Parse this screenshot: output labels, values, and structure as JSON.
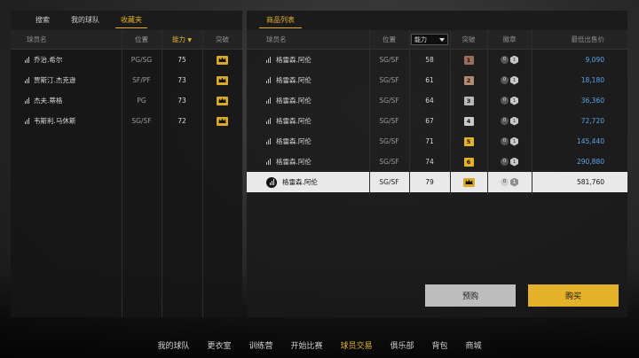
{
  "left_panel": {
    "tabs": [
      {
        "label": "搜索",
        "active": false
      },
      {
        "label": "我的球队",
        "active": false
      },
      {
        "label": "收藏夹",
        "active": true
      }
    ],
    "headers": {
      "name": "球员名",
      "position": "位置",
      "overall": "能力",
      "breakthrough": "突破"
    },
    "rows": [
      {
        "name": "乔治.希尔",
        "position": "PG/SG",
        "overall": "75"
      },
      {
        "name": "贾斯汀.杰克逊",
        "position": "SF/PF",
        "overall": "73"
      },
      {
        "name": "杰夫.蒂格",
        "position": "PG",
        "overall": "73"
      },
      {
        "name": "韦斯利.马休斯",
        "position": "SG/SF",
        "overall": "72"
      }
    ]
  },
  "right_panel": {
    "title": "商品列表",
    "headers": {
      "name": "球员名",
      "position": "位置",
      "overall": "能力",
      "breakthrough": "突破",
      "badge": "徽章",
      "price": "最低出售价"
    },
    "rows": [
      {
        "name": "格雷森.阿伦",
        "position": "SG/SF",
        "overall": "58",
        "brk": "1",
        "brk_color": "#9c6b5a",
        "badge_a": "0",
        "badge_b": "1",
        "price": "9,090",
        "selected": false
      },
      {
        "name": "格雷森.阿伦",
        "position": "SG/SF",
        "overall": "61",
        "brk": "2",
        "brk_color": "#b48a72",
        "badge_a": "0",
        "badge_b": "1",
        "price": "18,180",
        "selected": false
      },
      {
        "name": "格雷森.阿伦",
        "position": "SG/SF",
        "overall": "64",
        "brk": "3",
        "brk_color": "#b8b8b8",
        "badge_a": "0",
        "badge_b": "1",
        "price": "36,360",
        "selected": false
      },
      {
        "name": "格雷森.阿伦",
        "position": "SG/SF",
        "overall": "67",
        "brk": "4",
        "brk_color": "#c9c9c9",
        "badge_a": "0",
        "badge_b": "1",
        "price": "72,720",
        "selected": false
      },
      {
        "name": "格雷森.阿伦",
        "position": "SG/SF",
        "overall": "71",
        "brk": "5",
        "brk_color": "#e3b22a",
        "badge_a": "0",
        "badge_b": "1",
        "price": "145,440",
        "selected": false
      },
      {
        "name": "格雷森.阿伦",
        "position": "SG/SF",
        "overall": "74",
        "brk": "6",
        "brk_color": "#e3b22a",
        "badge_a": "0",
        "badge_b": "1",
        "price": "290,880",
        "selected": false
      },
      {
        "name": "格雷森.阿伦",
        "position": "SG/SF",
        "overall": "79",
        "brk": "",
        "brk_color": "#d9a92a",
        "badge_a": "0",
        "badge_b": "1",
        "price": "581,760",
        "selected": true
      }
    ],
    "buttons": {
      "preorder": "预购",
      "buy": "购买"
    }
  },
  "bottom_nav": [
    {
      "label": "我的球队",
      "active": false
    },
    {
      "label": "更衣室",
      "active": false
    },
    {
      "label": "训练营",
      "active": false
    },
    {
      "label": "开始比赛",
      "active": false
    },
    {
      "label": "球员交易",
      "active": true
    },
    {
      "label": "俱乐部",
      "active": false
    },
    {
      "label": "背包",
      "active": false
    },
    {
      "label": "商城",
      "active": false
    }
  ],
  "colors": {
    "accent": "#e3b22a",
    "price": "#5aa4e6"
  },
  "icons": {
    "player_row": "signal-bars-icon",
    "breakthrough_max": "crown-icon",
    "sort": "caret-down-icon"
  }
}
